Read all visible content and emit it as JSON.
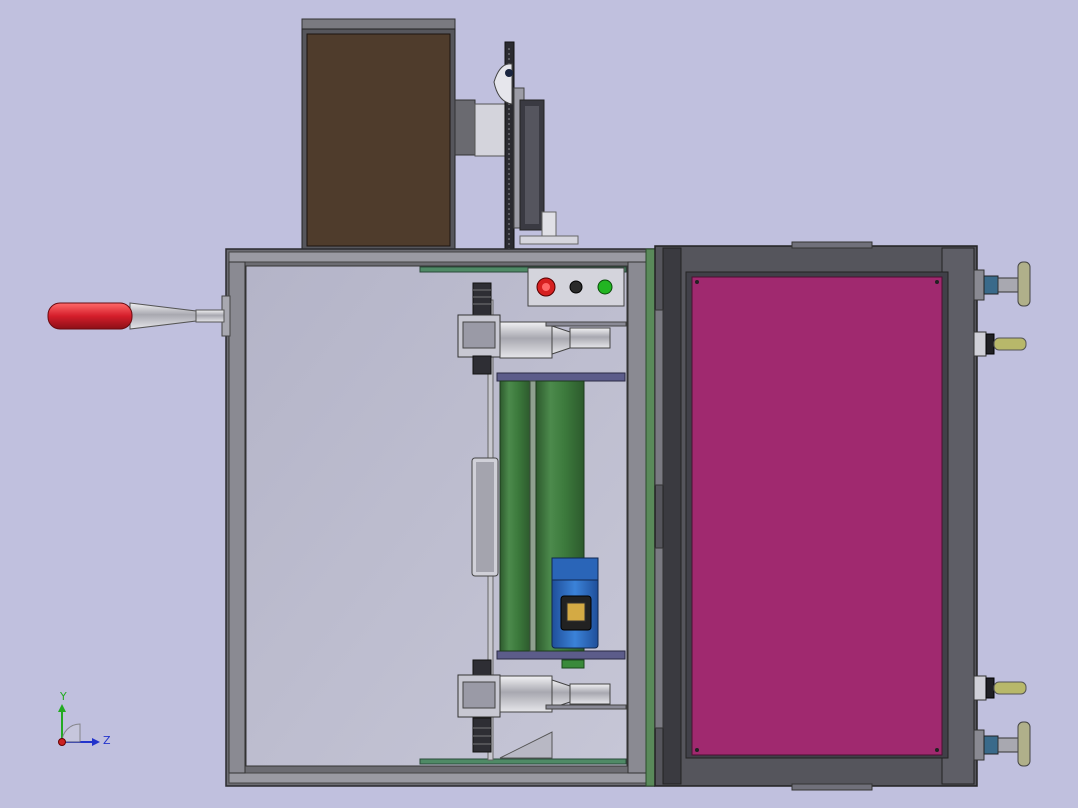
{
  "viewport": {
    "background": "#c0c0de"
  },
  "model": {
    "frame_color": "#707075",
    "front_panel_color": "#a0296f",
    "cabinet_color": "#4f3c2c",
    "handle_color": "#d51e2b",
    "motor_color": "#2f6fc4",
    "guide_color": "#3f7a3f",
    "button_colors": [
      "#d62020",
      "#2a2a2a",
      "#22b522"
    ]
  },
  "triad": {
    "y_label": "Y",
    "z_label": "Z",
    "y_color": "#22aa22",
    "z_color": "#2233cc",
    "x_color": "#cc2222"
  }
}
